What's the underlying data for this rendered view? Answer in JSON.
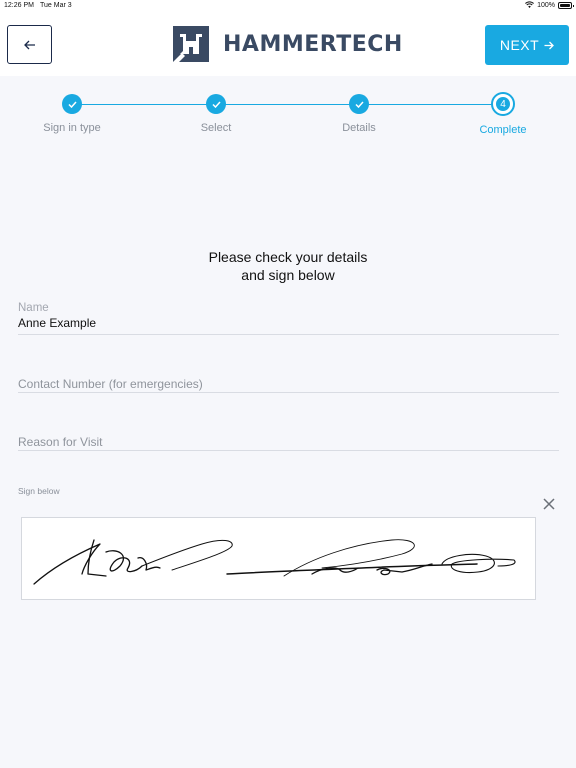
{
  "status_bar": {
    "time": "12:26 PM",
    "date": "Tue Mar 3",
    "battery": "100%",
    "wifi_icon": "wifi-icon",
    "battery_icon": "battery-icon"
  },
  "header": {
    "back_icon": "arrow-left-icon",
    "logo_text": "HAMMERTECH",
    "next_label": "NEXT",
    "next_icon": "arrow-right-icon",
    "accent_color": "#19a9e1",
    "brand_color": "#3a4a63"
  },
  "stepper": {
    "steps": [
      {
        "label": "Sign in type",
        "state": "done"
      },
      {
        "label": "Select",
        "state": "done"
      },
      {
        "label": "Details",
        "state": "done"
      },
      {
        "label": "Complete",
        "state": "current",
        "number": "4"
      }
    ]
  },
  "instructions": {
    "line1": "Please check your details",
    "line2": "and sign below"
  },
  "form": {
    "name": {
      "label": "Name",
      "value": "Anne Example"
    },
    "contact": {
      "placeholder": "Contact Number (for emergencies)"
    },
    "reason": {
      "placeholder": "Reason for Visit"
    },
    "sign_label": "Sign below",
    "clear_icon": "close-icon"
  }
}
